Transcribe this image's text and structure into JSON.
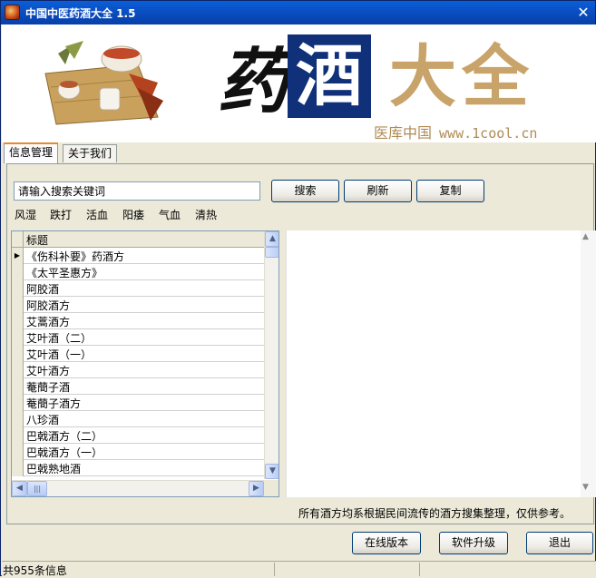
{
  "window": {
    "title": "中国中医药酒大全 1.5",
    "close_glyph": "✕"
  },
  "banner": {
    "char1": "药",
    "char2": "酒",
    "char3": "大全",
    "tagline": "医库中国",
    "url": "www.1cool.cn"
  },
  "tabs": [
    "信息管理",
    "关于我们"
  ],
  "search": {
    "placeholder": "请输入搜索关键词",
    "value": "请输入搜索关键词"
  },
  "buttons": {
    "search": "搜索",
    "refresh": "刷新",
    "copy": "复制",
    "online": "在线版本",
    "upgrade": "软件升级",
    "exit": "退出"
  },
  "keywords": [
    "风湿",
    "跌打",
    "活血",
    "阳痿",
    "气血",
    "清热"
  ],
  "grid": {
    "column": "标题",
    "selected_index": 0,
    "rows": [
      "《伤科补要》药酒方",
      "《太平圣惠方》",
      "阿胶酒",
      "阿胶酒方",
      "艾蒿酒方",
      "艾叶酒（二）",
      "艾叶酒（一）",
      "艾叶酒方",
      "菴蕳子酒",
      "菴蕳子酒方",
      "八珍酒",
      "巴戟酒方（二）",
      "巴戟酒方（一）",
      "巴戟熟地酒"
    ]
  },
  "note": "所有酒方均系根据民间流传的酒方搜集整理，仅供参考。",
  "status": {
    "count_text": "共955条信息"
  }
}
